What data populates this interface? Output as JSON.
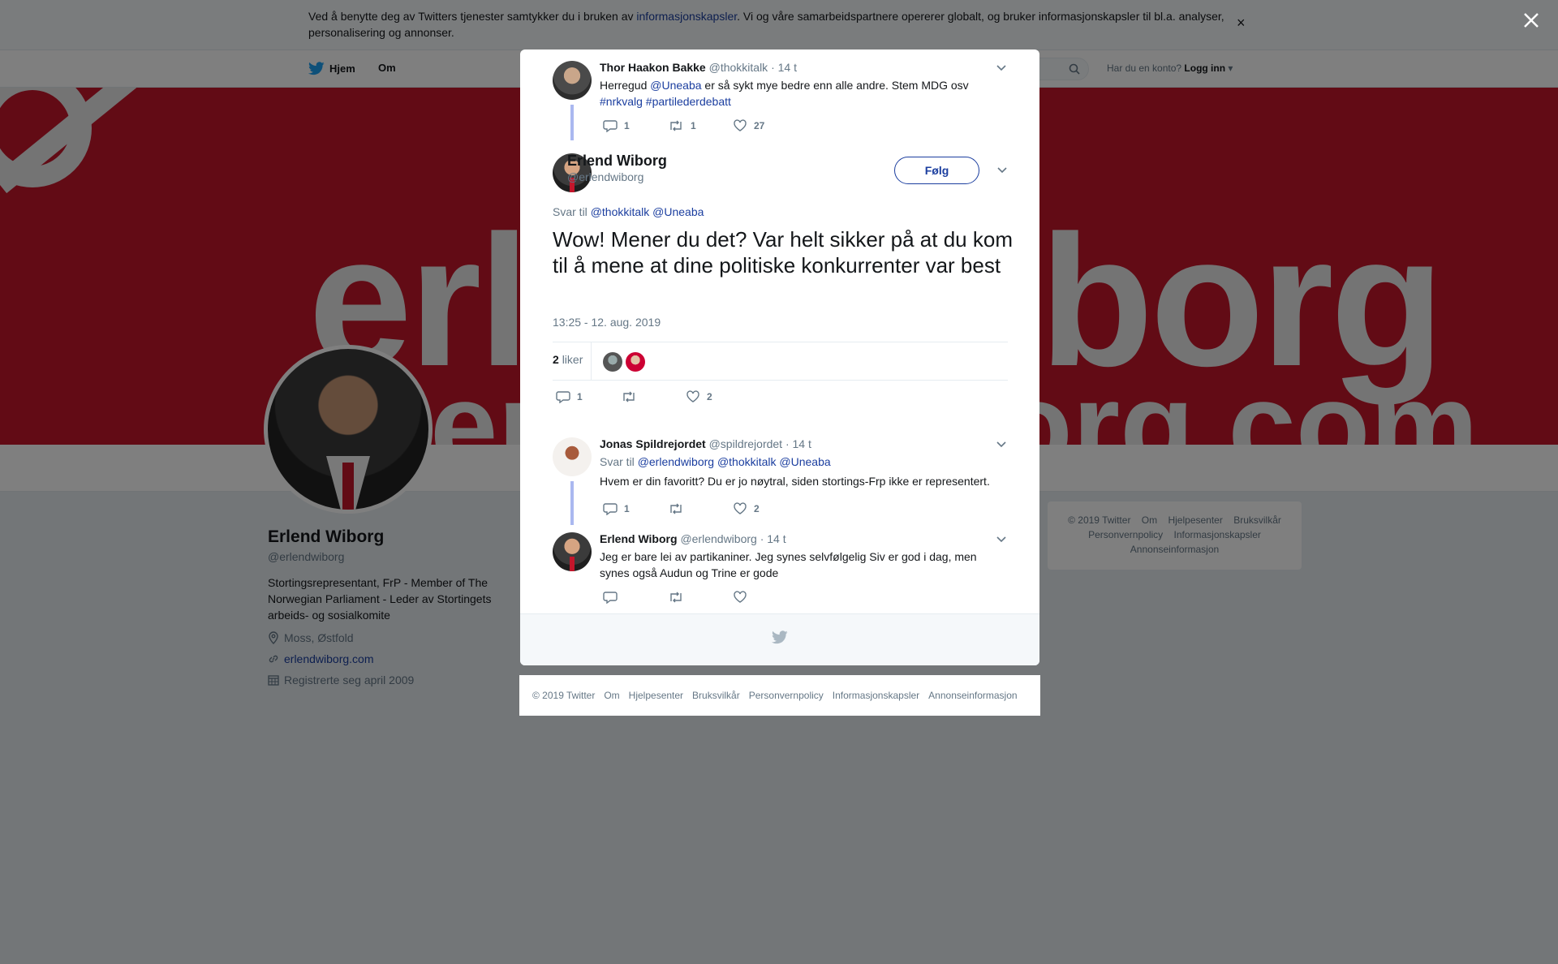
{
  "cookie": {
    "text_before": "Ved å benytte deg av Twitters tjenester samtykker du i bruken av ",
    "link": "informasjonskapsler",
    "text_after": ". Vi og våre samarbeidspartnere opererer globalt, og bruker informasjonskapsler til bl.a. analyser, personalisering og annonser.",
    "close": "×"
  },
  "nav": {
    "home": "Hjem",
    "about": "Om",
    "login_prompt": "Har du en konto?",
    "login": "Logg inn"
  },
  "profile": {
    "name": "Erlend Wiborg",
    "handle": "@erlendwiborg",
    "bio": "Stortingsrepresentant, FrP - Member of The Norwegian Parliament - Leder av Stortingets arbeids- og sosialkomite",
    "location": "Moss, Østfold",
    "website": "erlendwiborg.com",
    "joined": "Registrerte seg april 2009"
  },
  "banner": {
    "word1": "erlendwiborg",
    "word2": "erlendwiborg.com"
  },
  "right_footer": {
    "items": [
      "© 2019 Twitter",
      "Om",
      "Hjelpesenter",
      "Bruksvilkår",
      "Personvernpolicy",
      "Informasjonskapsler",
      "Annonseinformasjon"
    ]
  },
  "thread": {
    "parent": {
      "name": "Thor Haakon Bakke",
      "handle": "@thokkitalk",
      "time": "· 14 t",
      "text_before": "Herregud ",
      "mention": "@Uneaba",
      "text_after": " er så sykt mye bedre enn alle andre. Stem MDG osv",
      "hashtags": "#nrkvalg #partilederdebatt",
      "replies": "1",
      "retweets": "1",
      "likes": "27"
    },
    "main": {
      "name": "Erlend Wiborg",
      "handle": "@erlendwiborg",
      "follow": "Følg",
      "reply_label": "Svar til",
      "reply_mentions": "@thokkitalk @Uneaba",
      "text": "Wow! Mener du det? Var helt sikker på at du kom til å mene at dine politiske konkurrenter var best",
      "date": "13:25 - 12. aug. 2019",
      "likes_count": "2",
      "likes_label": "liker",
      "replies": "1",
      "retweets": "",
      "likes": "2"
    },
    "reply1": {
      "name": "Jonas Spildrejordet",
      "handle": "@spildrejordet",
      "time": "· 14 t",
      "reply_label": "Svar til",
      "reply_mentions": "@erlendwiborg @thokkitalk @Uneaba",
      "text": "Hvem er din favoritt? Du er jo nøytral, siden stortings-Frp ikke er representert.",
      "replies": "1",
      "retweets": "",
      "likes": "2"
    },
    "reply2": {
      "name": "Erlend Wiborg",
      "handle": "@erlendwiborg",
      "time": "· 14 t",
      "text": "Jeg er bare lei av partikaniner. Jeg synes selvfølgelig Siv er god i dag, men synes også Audun og Trine er gode",
      "replies": "",
      "retweets": "",
      "likes": ""
    }
  },
  "modal_footer": {
    "items": [
      "© 2019 Twitter",
      "Om",
      "Hjelpesenter",
      "Bruksvilkår",
      "Personvernpolicy",
      "Informasjonskapsler",
      "Annonseinformasjon"
    ]
  },
  "colors": {
    "link": "#1b3e9f",
    "banner_red": "#c4162b",
    "thread_line": "#aab8f0",
    "muted": "#657786"
  }
}
